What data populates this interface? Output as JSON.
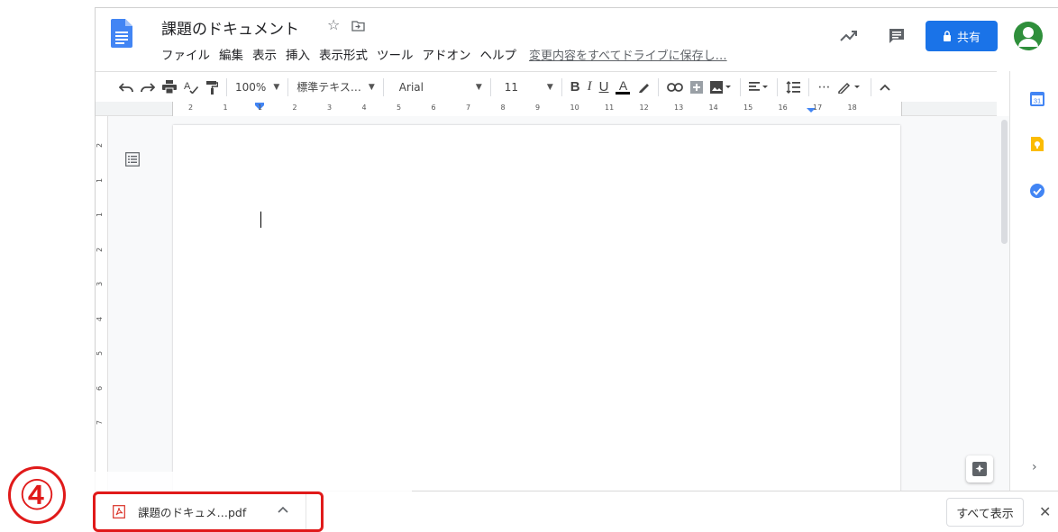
{
  "document": {
    "title": "課題のドキュメント",
    "star_icon": "star-outline-icon",
    "move_icon": "move-to-folder-icon"
  },
  "menu": {
    "items": [
      "ファイル",
      "編集",
      "表示",
      "挿入",
      "表示形式",
      "ツール",
      "アドオン",
      "ヘルプ"
    ],
    "save_status": "変更内容をすべてドライブに保存し…"
  },
  "header": {
    "share_label": "共有",
    "share_icon": "lock-icon",
    "activity_icon": "trending-icon",
    "comments_icon": "comment-icon",
    "avatar_icon": "account-avatar-icon"
  },
  "toolbar": {
    "zoom": "100%",
    "style": "標準テキス…",
    "font": "Arial",
    "font_size": "11",
    "bold": "B",
    "italic": "I",
    "underline": "U",
    "text_color": "A",
    "more": "⋯"
  },
  "ruler": {
    "labels": [
      "2",
      "1",
      "1",
      "2",
      "3",
      "4",
      "5",
      "6",
      "7",
      "8",
      "9",
      "10",
      "11",
      "12",
      "13",
      "14",
      "15",
      "16",
      "17",
      "18"
    ]
  },
  "vertical_ruler": {
    "labels": [
      "2",
      "1",
      "1",
      "2",
      "3",
      "4",
      "5",
      "6",
      "7"
    ]
  },
  "side_panel": {
    "icons": [
      "calendar-icon",
      "keep-icon",
      "tasks-icon"
    ],
    "calendar_day": "31"
  },
  "download_bar": {
    "file_name": "課題のドキュメ…pdf",
    "show_all_label": "すべて表示",
    "close_label": "✕"
  },
  "annotation": {
    "step_number": "④"
  },
  "colors": {
    "accent": "#1a73e8",
    "annotation_red": "#e01a1a",
    "avatar_green": "#2f8f3b",
    "doc_blue": "#4285f4"
  }
}
